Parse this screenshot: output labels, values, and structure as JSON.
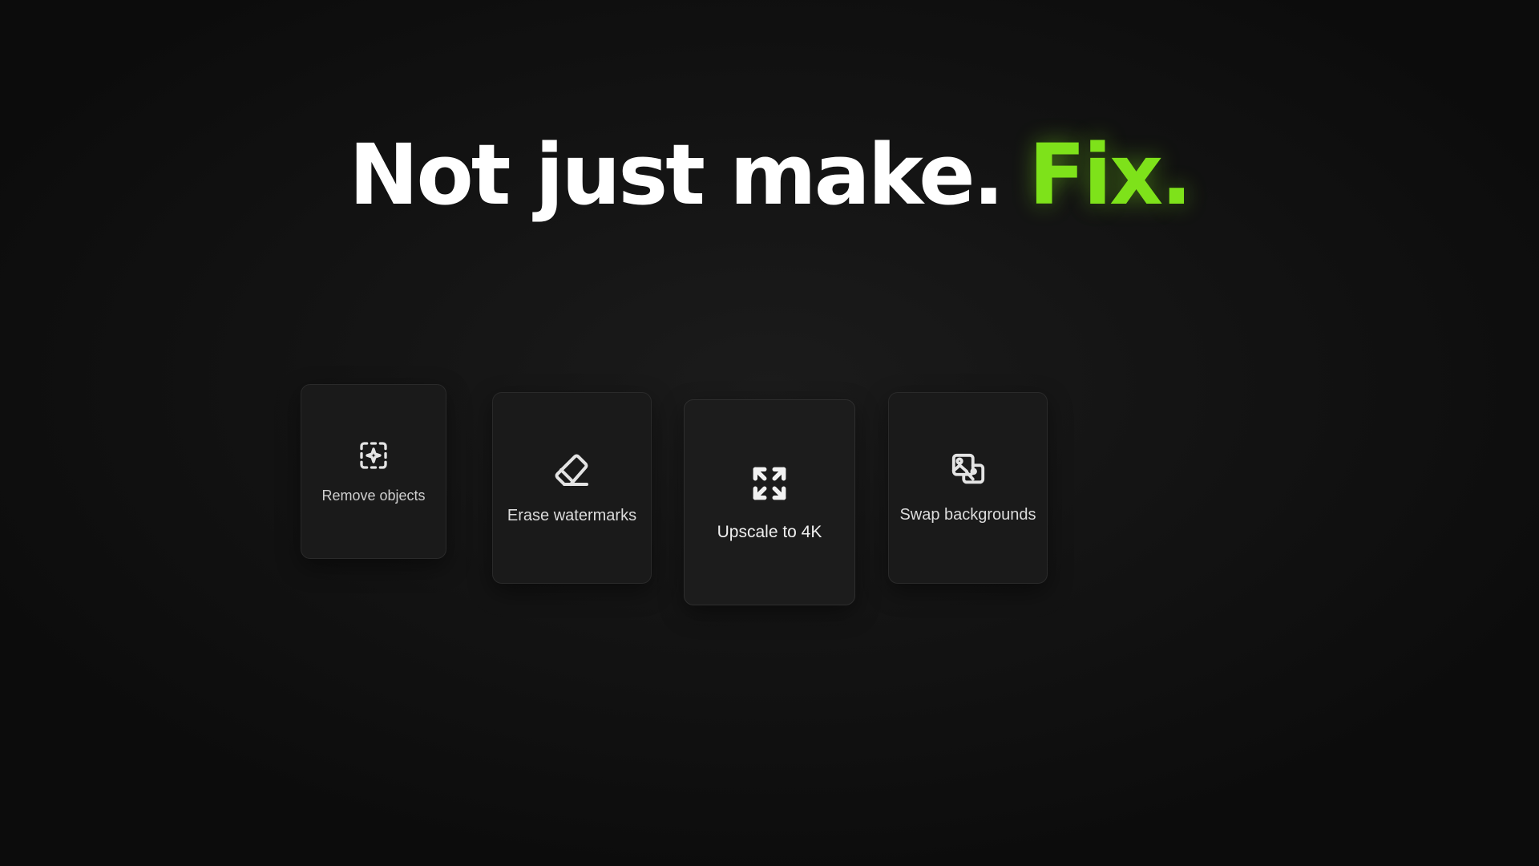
{
  "headline": {
    "main": "Not just make.",
    "accent": "Fix.",
    "accent_color": "#7ee21a"
  },
  "features": [
    {
      "label": "Remove objects",
      "icon": "dashed-selection-sparkle-icon"
    },
    {
      "label": "Erase watermarks",
      "icon": "eraser-icon"
    },
    {
      "label": "Upscale to 4K",
      "icon": "expand-arrows-icon"
    },
    {
      "label": "Swap backgrounds",
      "icon": "images-swap-icon"
    }
  ]
}
